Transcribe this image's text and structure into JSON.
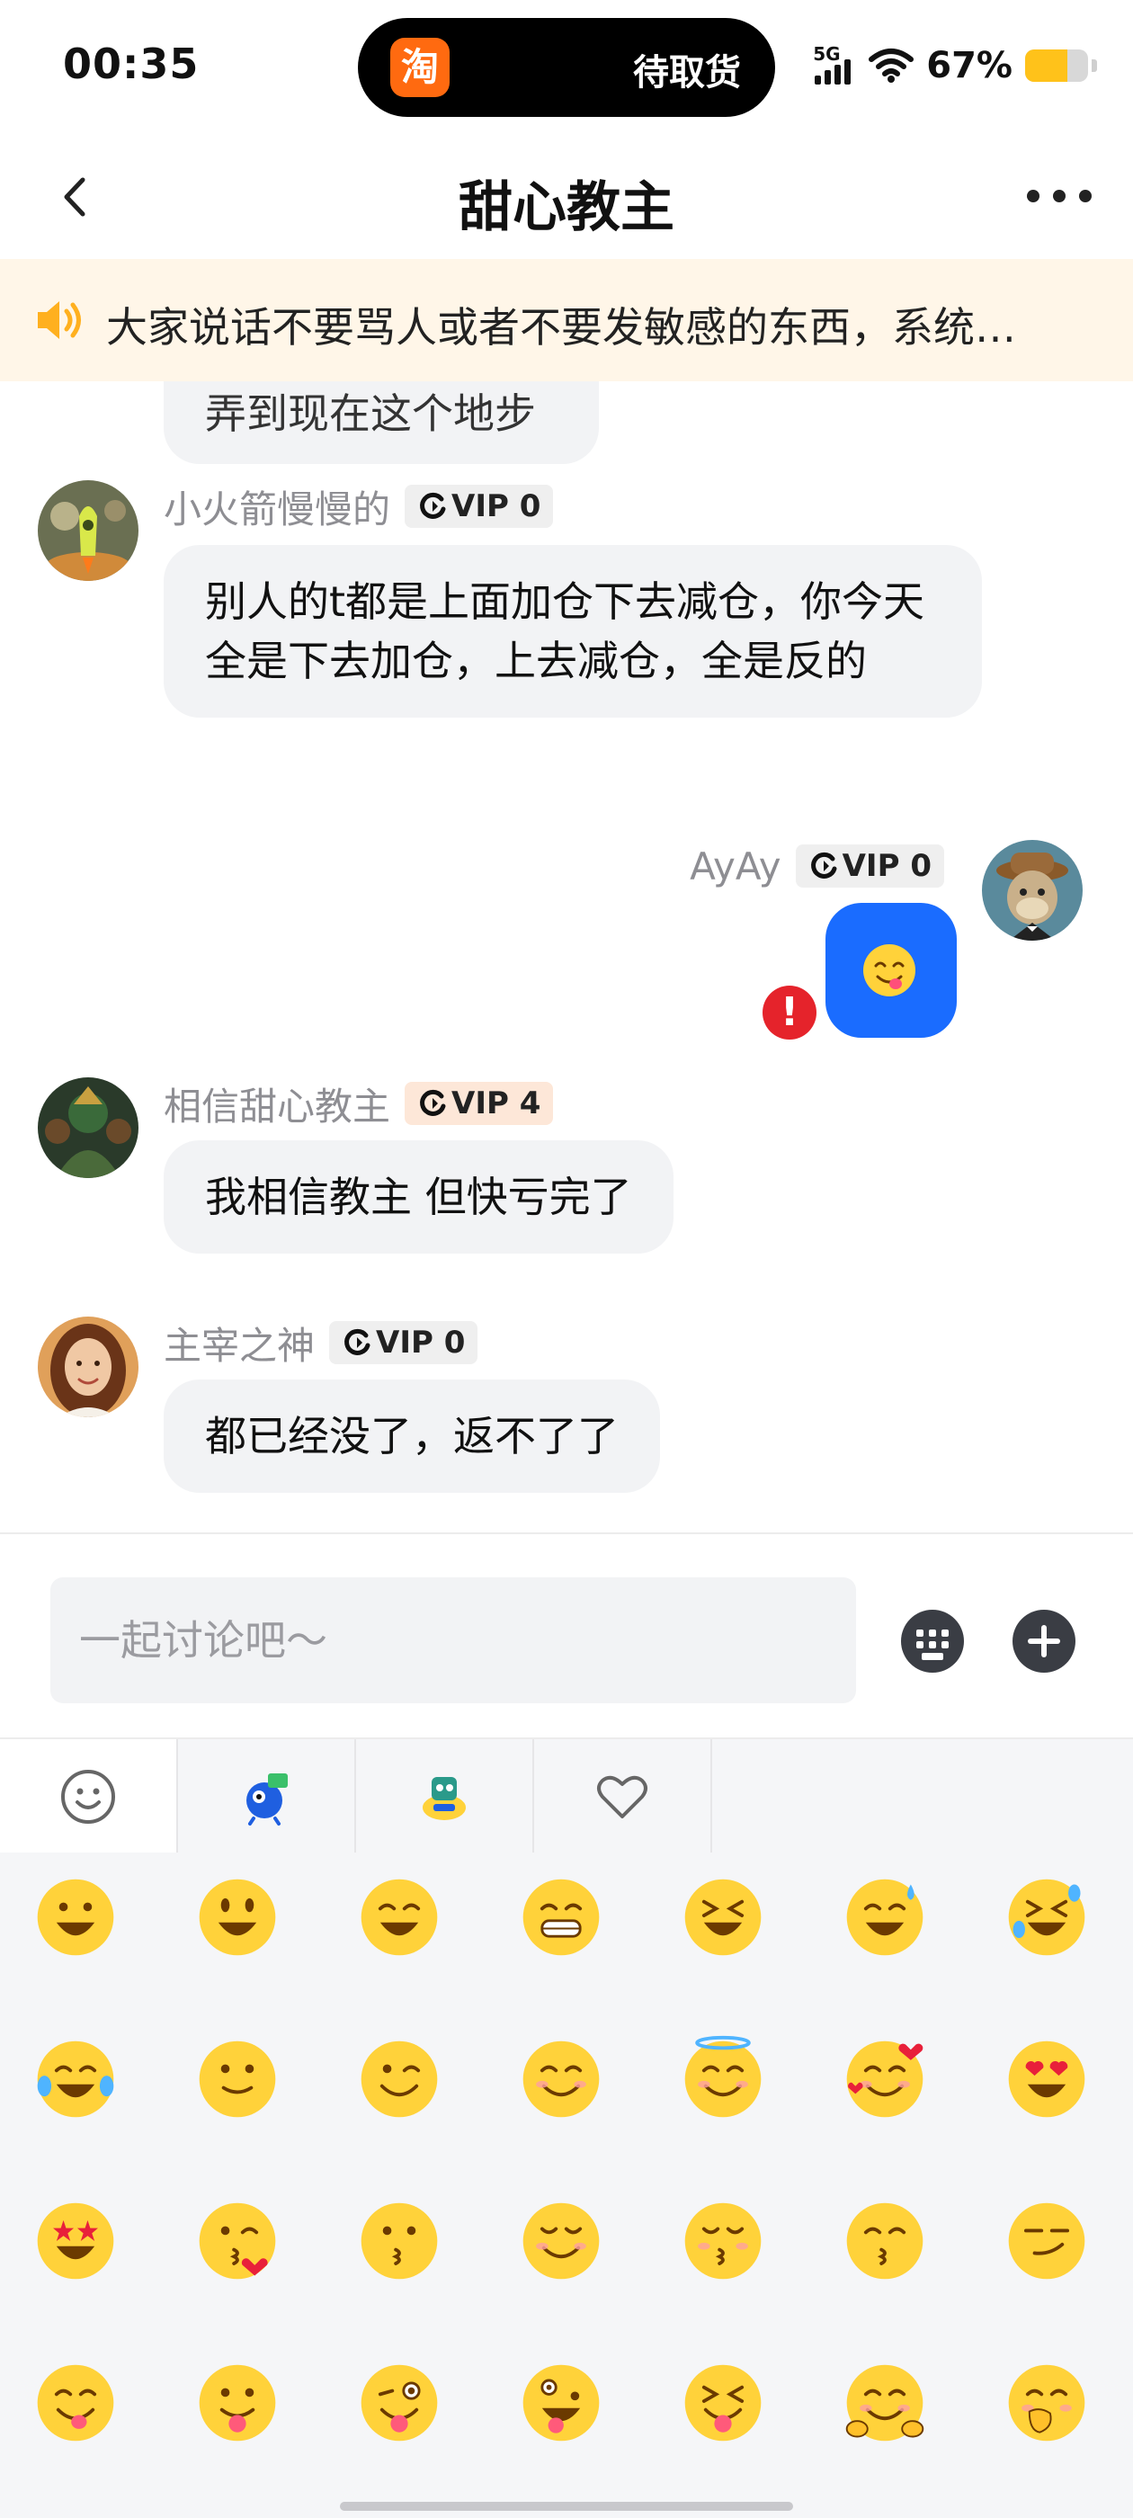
{
  "status_bar": {
    "time": "00:35",
    "island_app_icon": "淘",
    "island_text": "待取货",
    "network": "5G",
    "battery_percent": "67%",
    "battery_level": 0.67,
    "battery_color": "#ffc21a"
  },
  "nav": {
    "title": "甜心教主"
  },
  "announcement": {
    "text": "大家说话不要骂人或者不要发敏感的东西，系统…"
  },
  "messages": {
    "cut_off": {
      "text": "弄到现在这个地步"
    },
    "m1": {
      "sender": "小火箭慢慢的",
      "vip": "VIP 0",
      "text": "别人的t都是上面加仓下去减仓，你今天全是下去加仓，上去减仓，全是反的"
    },
    "m2": {
      "sender": "AyAy",
      "vip": "VIP 0",
      "content_icon": "yum-face-emoji",
      "status": "send-failed"
    },
    "m3": {
      "sender": "相信甜心教主",
      "vip": "VIP 4",
      "text": "我相信教主 但快亏完了"
    },
    "m4": {
      "sender": "主宰之神",
      "vip": "VIP 0",
      "text": "都已经没了，返不了了"
    }
  },
  "input": {
    "placeholder": "一起讨论吧～",
    "value": ""
  },
  "emoji_tabs": [
    "smiley-tab",
    "sticker-pack-1-tab",
    "sticker-pack-2-tab",
    "favorites-heart-tab"
  ],
  "emoji_rows": [
    [
      "grinning",
      "smiley",
      "smile",
      "grin",
      "laughing",
      "sweat-smile",
      "rofl"
    ],
    [
      "joy",
      "slightly-smiling",
      "wink",
      "blush",
      "innocent",
      "smiling-hearts",
      "heart-eyes"
    ],
    [
      "star-struck",
      "kissing-heart",
      "kissing",
      "relaxed",
      "kissing-closed-eyes",
      "kissing-smiling-eyes",
      "smirk"
    ],
    [
      "yum",
      "tongue",
      "stuck-out-tongue-wink",
      "zany",
      "squinting-tongue",
      "hugging",
      "hand-over-mouth"
    ]
  ],
  "colors": {
    "accent_blue": "#1a6cff",
    "error_red": "#e5232b",
    "notice_bg": "#fff6e8",
    "bubble_bg": "#f2f3f5"
  }
}
